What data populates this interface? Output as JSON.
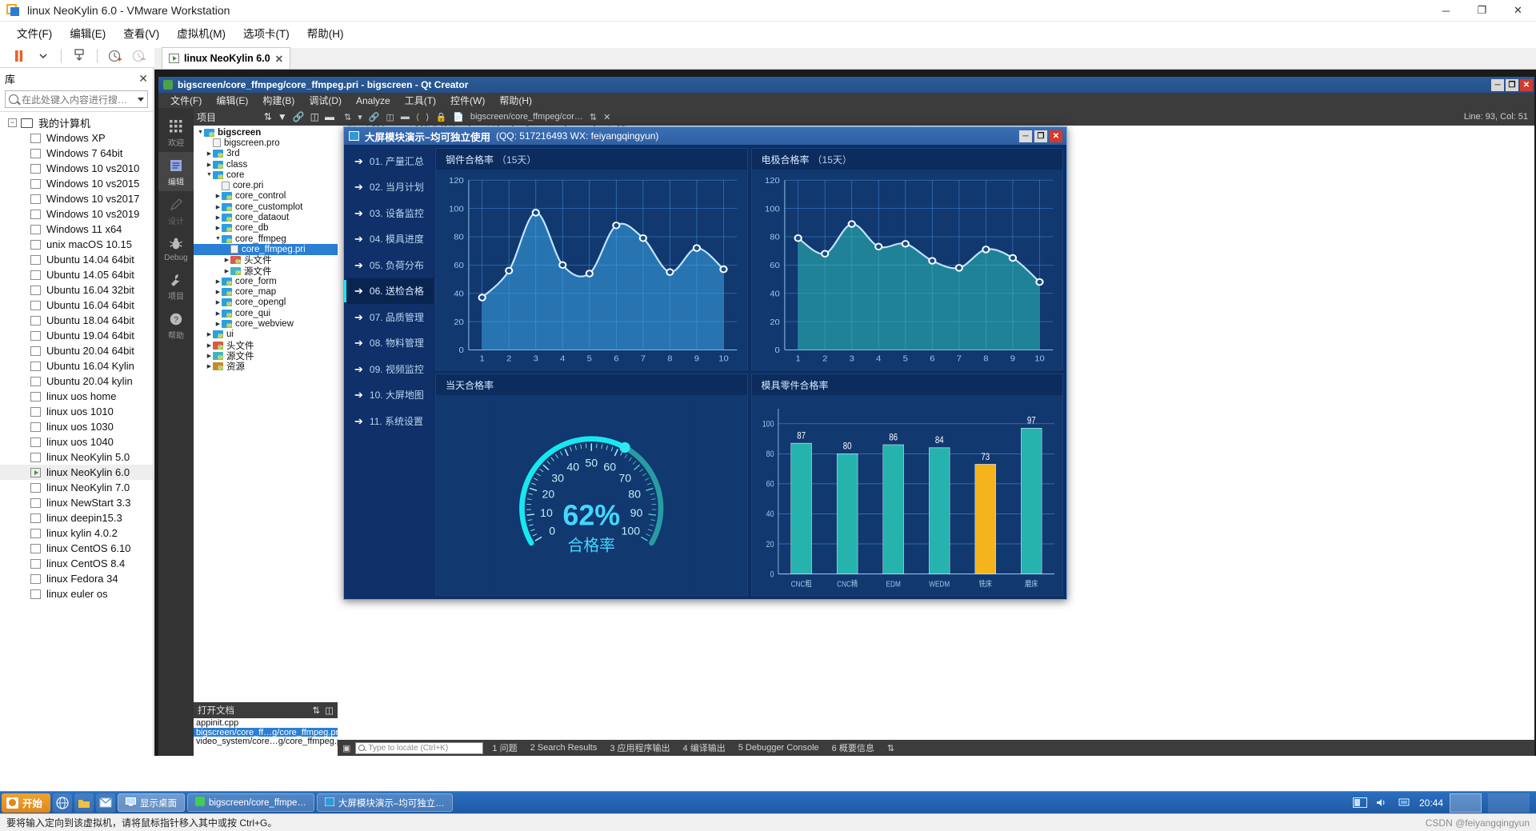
{
  "vmware": {
    "title": "linux NeoKylin 6.0 - VMware Workstation",
    "window_controls": {
      "minimize": "─",
      "maximize": "❐",
      "close": "✕"
    },
    "menu": [
      "文件(F)",
      "编辑(E)",
      "查看(V)",
      "虚拟机(M)",
      "选项卡(T)",
      "帮助(H)"
    ],
    "library": {
      "header": "库",
      "close_label": "✕",
      "search_placeholder": "在此处键入内容进行搜…",
      "root": "我的计算机",
      "items": [
        "Windows XP",
        "Windows 7 64bit",
        "Windows 10 vs2010",
        "Windows 10 vs2015",
        "Windows 10 vs2017",
        "Windows 10 vs2019",
        "Windows 11 x64",
        "unix macOS 10.15",
        "Ubuntu 14.04 64bit",
        "Ubuntu 14.05 64bit",
        "Ubuntu 16.04 32bit",
        "Ubuntu 16.04 64bit",
        "Ubuntu 18.04 64bit",
        "Ubuntu 19.04 64bit",
        "Ubuntu 20.04 64bit",
        "Ubuntu 16.04 Kylin",
        "Ubuntu 20.04 kylin",
        "linux uos home",
        "linux uos 1010",
        "linux uos 1030",
        "linux uos 1040",
        "linux NeoKylin 5.0",
        "linux NeoKylin 6.0",
        "linux NeoKylin 7.0",
        "linux NewStart 3.3",
        "linux deepin15.3",
        "linux kylin 4.0.2",
        "linux CentOS 6.10",
        "linux CentOS 8.4",
        "linux Fedora 34",
        "linux euler os"
      ],
      "selected": "linux NeoKylin 6.0"
    },
    "guest_tab": "linux NeoKylin 6.0",
    "status_text": "要将输入定向到该虚拟机，请将鼠标指针移入其中或按 Ctrl+G。",
    "watermark": "CSDN @feiyangqingyun"
  },
  "qtcreator": {
    "title": "bigscreen/core_ffmpeg/core_ffmpeg.pri - bigscreen - Qt Creator",
    "window_controls": {
      "minimize": "─",
      "maximize": "❐",
      "close": "✕"
    },
    "menu": [
      "文件(F)",
      "编辑(E)",
      "构建(B)",
      "调试(D)",
      "Analyze",
      "工具(T)",
      "控件(W)",
      "帮助(H)"
    ],
    "modes": [
      {
        "label": "欢迎",
        "icon": "grid-icon"
      },
      {
        "label": "编辑",
        "icon": "document-icon"
      },
      {
        "label": "设计",
        "icon": "pencil-icon"
      },
      {
        "label": "Debug",
        "icon": "bug-icon"
      },
      {
        "label": "项目",
        "icon": "wrench-icon"
      },
      {
        "label": "帮助",
        "icon": "question-icon"
      }
    ],
    "active_mode": "编辑",
    "project_panel_title": "项目",
    "tree": [
      {
        "depth": 0,
        "label": "bigscreen",
        "type": "folder",
        "arrow": "▼",
        "bold": true
      },
      {
        "depth": 1,
        "label": "bigscreen.pro",
        "type": "file",
        "arrow": ""
      },
      {
        "depth": 1,
        "label": "3rd",
        "type": "folder",
        "arrow": "▶"
      },
      {
        "depth": 1,
        "label": "class",
        "type": "folder",
        "arrow": "▶"
      },
      {
        "depth": 1,
        "label": "core",
        "type": "folder",
        "arrow": "▼"
      },
      {
        "depth": 2,
        "label": "core.pri",
        "type": "file",
        "arrow": ""
      },
      {
        "depth": 2,
        "label": "core_control",
        "type": "folder",
        "arrow": "▶"
      },
      {
        "depth": 2,
        "label": "core_customplot",
        "type": "folder",
        "arrow": "▶"
      },
      {
        "depth": 2,
        "label": "core_dataout",
        "type": "folder",
        "arrow": "▶"
      },
      {
        "depth": 2,
        "label": "core_db",
        "type": "folder",
        "arrow": "▶"
      },
      {
        "depth": 2,
        "label": "core_ffmpeg",
        "type": "folder",
        "arrow": "▼"
      },
      {
        "depth": 3,
        "label": "core_ffmpeg.pri",
        "type": "file",
        "arrow": "",
        "selected": true
      },
      {
        "depth": 3,
        "label": "头文件",
        "type": "folder-h",
        "arrow": "▶"
      },
      {
        "depth": 3,
        "label": "源文件",
        "type": "folder-cpp",
        "arrow": "▶"
      },
      {
        "depth": 2,
        "label": "core_form",
        "type": "folder",
        "arrow": "▶"
      },
      {
        "depth": 2,
        "label": "core_map",
        "type": "folder",
        "arrow": "▶"
      },
      {
        "depth": 2,
        "label": "core_opengl",
        "type": "folder",
        "arrow": "▶"
      },
      {
        "depth": 2,
        "label": "core_qui",
        "type": "folder",
        "arrow": "▶"
      },
      {
        "depth": 2,
        "label": "core_webview",
        "type": "folder",
        "arrow": "▶"
      },
      {
        "depth": 1,
        "label": "ui",
        "type": "folder",
        "arrow": "▶"
      },
      {
        "depth": 1,
        "label": "头文件",
        "type": "folder-h",
        "arrow": "▶"
      },
      {
        "depth": 1,
        "label": "源文件",
        "type": "folder-cpp",
        "arrow": "▶"
      },
      {
        "depth": 1,
        "label": "资源",
        "type": "folder-res",
        "arrow": "▶"
      }
    ],
    "open_documents_title": "打开文档",
    "open_documents": [
      {
        "label": "appinit.cpp",
        "selected": false
      },
      {
        "label": "bigscreen/core_ff…g/core_ffmpeg.pri",
        "selected": true
      },
      {
        "label": "video_system/core…g/core_ffmpeg.pri",
        "selected": false
      }
    ],
    "editor_filepath": "bigscreen/core_ffmpeg/cor…",
    "cursor_position": "Line: 93, Col: 51",
    "status_bar": {
      "locator_placeholder": "Type to locate (Ctrl+K)",
      "panes": [
        "1 问题",
        "2 Search Results",
        "3 应用程序输出",
        "4 编译输出",
        "5 Debugger Console",
        "6 概要信息"
      ]
    }
  },
  "bigscreen": {
    "title": "大屏模块演示–均可独立使用",
    "subtitle": "(QQ: 517216493  WX: feiyangqingyun)",
    "window_controls": {
      "minimize": "─",
      "maximize": "❐",
      "close": "✕"
    },
    "nav": [
      "01. 产量汇总",
      "02. 当月计划",
      "03. 设备监控",
      "04. 模具进度",
      "05. 负荷分布",
      "06. 送检合格",
      "07. 品质管理",
      "08. 物料管理",
      "09. 视频监控",
      "10. 大屏地图",
      "11. 系统设置"
    ],
    "nav_active": "06. 送检合格",
    "colors": {
      "panel_bg": "#11386f",
      "header_bg": "#0c2c5e",
      "nav_bg": "#0f3068",
      "accent_cyan": "#19e7f0",
      "series_blue": "#3aa6e8",
      "series_teal": "#2ebfb8",
      "bar_teal": "#26b3ad",
      "bar_highlight": "#f5b31c",
      "grid": "#2f6fb5",
      "axis_text": "#9fc4e8"
    },
    "chart_data": [
      {
        "type": "area",
        "title": "钢件合格率",
        "unit": "（15天）",
        "x": [
          1,
          2,
          3,
          4,
          5,
          6,
          7,
          8,
          9,
          10
        ],
        "values": [
          37,
          56,
          97,
          60,
          54,
          88,
          79,
          55,
          72,
          57
        ],
        "xlabel": "",
        "ylabel": "",
        "ylim": [
          0,
          120
        ],
        "yticks": [
          0,
          20,
          40,
          60,
          80,
          100,
          120
        ],
        "grid": true,
        "color": "#3aa6e8"
      },
      {
        "type": "area",
        "title": "电极合格率",
        "unit": "（15天）",
        "x": [
          1,
          2,
          3,
          4,
          5,
          6,
          7,
          8,
          9,
          10
        ],
        "values": [
          79,
          68,
          89,
          73,
          75,
          63,
          58,
          71,
          65,
          48
        ],
        "xlabel": "",
        "ylabel": "",
        "ylim": [
          0,
          120
        ],
        "yticks": [
          0,
          20,
          40,
          60,
          80,
          100,
          120
        ],
        "grid": true,
        "color": "#2ebfb8"
      },
      {
        "type": "gauge",
        "title": "当天合格率",
        "value": 62,
        "value_label": "62%",
        "caption": "合格率",
        "min": 0,
        "max": 100,
        "ticks": [
          0,
          10,
          20,
          30,
          40,
          50,
          60,
          70,
          80,
          90,
          100
        ],
        "color": "#19e7f0"
      },
      {
        "type": "bar",
        "title": "模具零件合格率",
        "categories": [
          "CNC粗",
          "CNC精",
          "EDM",
          "WEDM",
          "铣床",
          "磨床"
        ],
        "values": [
          87,
          80,
          86,
          84,
          73,
          97
        ],
        "highlight_index": 4,
        "ylim": [
          0,
          110
        ],
        "yticks": [
          0,
          20,
          40,
          60,
          80,
          100
        ],
        "grid": true,
        "color": "#26b3ad",
        "highlight_color": "#f5b31c"
      }
    ]
  },
  "taskbar": {
    "start_label": "开始",
    "quick_icons": [
      "globe-icon",
      "folder-icon",
      "mail-icon"
    ],
    "show_desktop_label": "显示桌面",
    "tasks": [
      {
        "label": "bigscreen/core_ffmpe…",
        "icon": "qt-icon",
        "selected": false
      },
      {
        "label": "大屏模块演示–均可独立…",
        "icon": "app-icon",
        "selected": false
      }
    ],
    "clock": "20:44"
  }
}
